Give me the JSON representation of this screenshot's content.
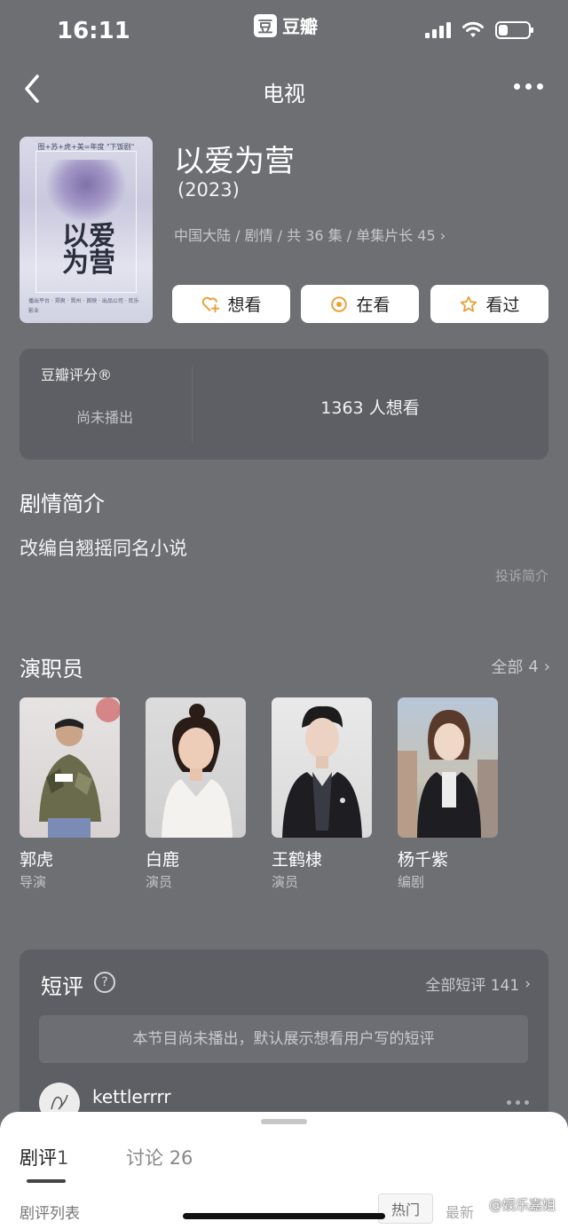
{
  "status_bar": {
    "time": "16:11",
    "app_logo_char": "豆",
    "app_name": "豆瓣",
    "battery_level": 0.3,
    "signal_bars": 4
  },
  "nav": {
    "title": "电视",
    "back_icon": "chevron-left-icon",
    "more_icon": "more-horizontal-icon"
  },
  "show": {
    "poster": {
      "top_text": "图+苏+虎+美=年度 \"下饭剧\"",
      "title": "以爱为营",
      "bottom_text": "播出平台 · 郑爽 · 晋州 · 首映 · 出品公司 · 欢乐影业"
    },
    "title": "以爱为营",
    "year": "(2023)",
    "meta": "中国大陆 / 剧情 / 共 36 集 / 单集片长 45",
    "actions": [
      {
        "label": "想看",
        "icon": "heart-plus-icon"
      },
      {
        "label": "在看",
        "icon": "target-icon"
      },
      {
        "label": "看过",
        "icon": "star-icon"
      }
    ]
  },
  "rating": {
    "label": "豆瓣评分®",
    "status": "尚未播出",
    "want_count": "1363 人想看"
  },
  "synopsis": {
    "title": "剧情简介",
    "text": "改编自翘摇同名小说",
    "report": "投诉简介"
  },
  "cast": {
    "title": "演职员",
    "all_label": "全部",
    "all_count": "4",
    "members": [
      {
        "name": "郭虎",
        "role": "导演"
      },
      {
        "name": "白鹿",
        "role": "演员"
      },
      {
        "name": "王鹤棣",
        "role": "演员"
      },
      {
        "name": "杨千紫",
        "role": "编剧"
      }
    ]
  },
  "short_reviews": {
    "title": "短评",
    "all_label": "全部短评 141",
    "notice": "本节目尚未播出，默认展示想看用户写的短评",
    "first_user": "kettlerrrr"
  },
  "sheet": {
    "tabs": [
      {
        "label": "剧评",
        "count": "1"
      },
      {
        "label": "讨论",
        "count": "26"
      }
    ],
    "list_title": "剧评列表",
    "sort_hot": "热门",
    "sort_latest": "最新",
    "watermark": "@娱乐嘉姐"
  },
  "colors": {
    "background": "#6e6f73",
    "card": "#5e5f64",
    "button_bg": "#ffffff",
    "accent_gold": "#e8a33b"
  }
}
